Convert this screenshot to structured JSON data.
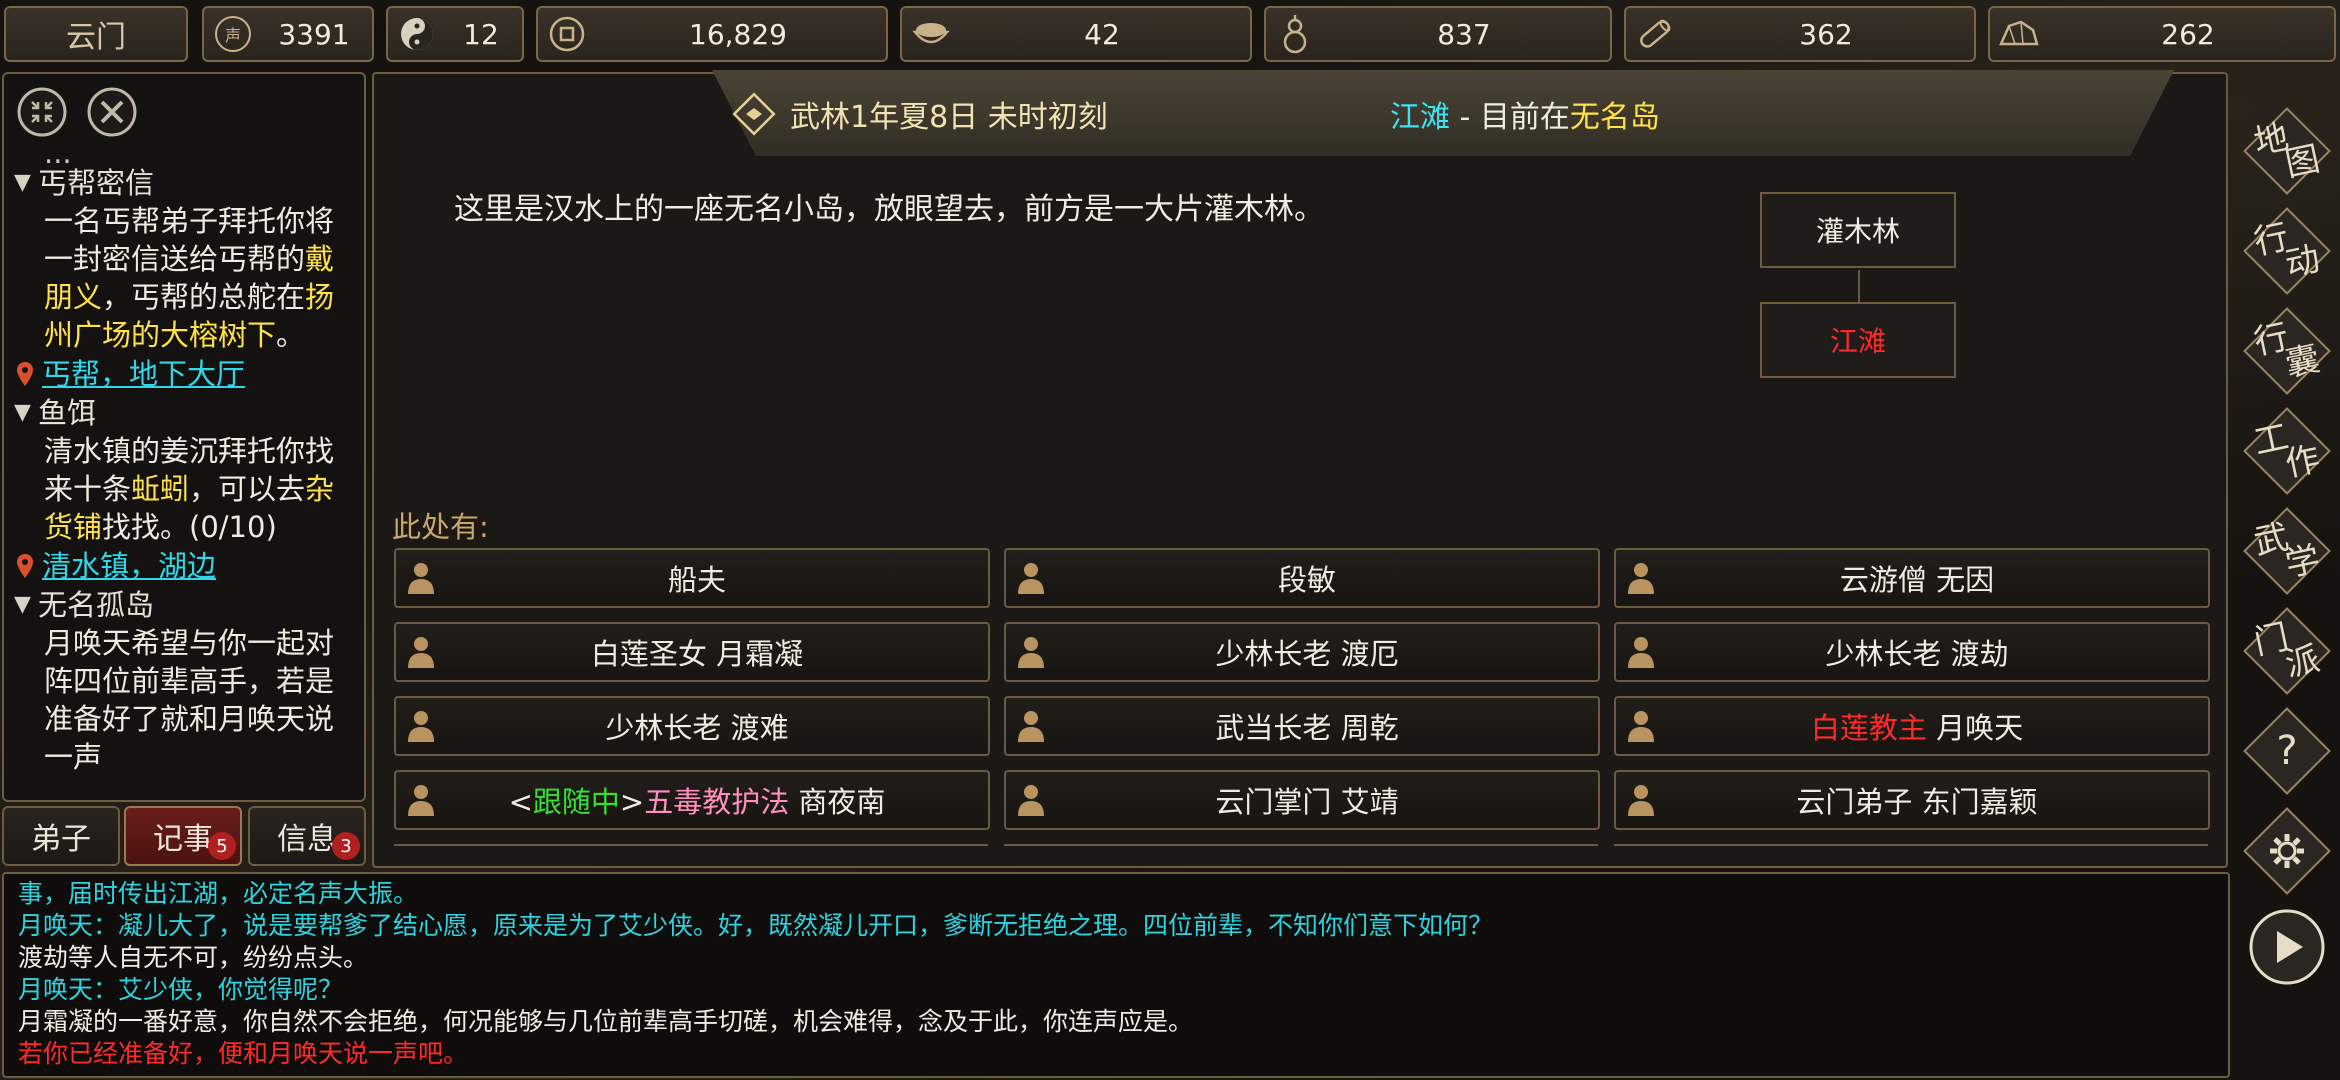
{
  "topbar": {
    "sect": "云门",
    "resources": [
      {
        "name": "reputation",
        "icon": "reputation-icon",
        "value": "3391"
      },
      {
        "name": "taiji",
        "icon": "taiji-icon",
        "value": "12"
      },
      {
        "name": "coins",
        "icon": "coin-icon",
        "value": "16,829"
      },
      {
        "name": "food",
        "icon": "rice-bowl-icon",
        "value": "42"
      },
      {
        "name": "medicine",
        "icon": "gourd-icon",
        "value": "837"
      },
      {
        "name": "wood",
        "icon": "log-icon",
        "value": "362"
      },
      {
        "name": "ore",
        "icon": "ore-icon",
        "value": "262"
      }
    ]
  },
  "quests": {
    "partial_top": "...",
    "items": [
      {
        "title": "丐帮密信",
        "body_parts": [
          {
            "t": "一名丐帮弟子拜托你将一封密信送给丐帮的"
          },
          {
            "t": "戴朋义",
            "hl": true
          },
          {
            "t": "，丐帮的总舵在"
          },
          {
            "t": "扬州广场的大榕树下",
            "hl": true
          },
          {
            "t": "。"
          }
        ],
        "location": "丐帮，地下大厅"
      },
      {
        "title": "鱼饵",
        "body_parts": [
          {
            "t": "清水镇的姜沉拜托你找来十条"
          },
          {
            "t": "蚯蚓",
            "hl": true
          },
          {
            "t": "，可以去"
          },
          {
            "t": "杂货铺",
            "hl": true
          },
          {
            "t": "找找。(0/10)"
          }
        ],
        "location": "清水镇，湖边"
      },
      {
        "title": "无名孤岛",
        "body_parts": [
          {
            "t": "月唤天希望与你一起对阵四位前辈高手，若是准备好了就和月唤天说一声"
          }
        ],
        "location": ""
      }
    ]
  },
  "left_tabs": [
    {
      "label": "弟子",
      "badge": ""
    },
    {
      "label": "记事",
      "badge": "5"
    },
    {
      "label": "信息",
      "badge": "3"
    }
  ],
  "header": {
    "date": "武林1年夏8日 未时初刻",
    "area": "江滩",
    "sep": " - 目前在",
    "place": "无名岛"
  },
  "description": "这里是汉水上的一座无名小岛，放眼望去，前方是一大片灌木林。",
  "minimap": {
    "north": "灌木林",
    "current": "江滩"
  },
  "here_label": "此处有:",
  "npcs": [
    {
      "parts": [
        {
          "t": "船夫"
        }
      ]
    },
    {
      "parts": [
        {
          "t": "段敏"
        }
      ]
    },
    {
      "parts": [
        {
          "t": "云游僧 无因"
        }
      ]
    },
    {
      "parts": [
        {
          "t": "白莲圣女 月霜凝"
        }
      ]
    },
    {
      "parts": [
        {
          "t": "少林长老 渡厄"
        }
      ]
    },
    {
      "parts": [
        {
          "t": "少林长老 渡劫"
        }
      ]
    },
    {
      "parts": [
        {
          "t": "少林长老 渡难"
        }
      ]
    },
    {
      "parts": [
        {
          "t": "武当长老 周乾"
        }
      ]
    },
    {
      "parts": [
        {
          "t": "白莲教主",
          "c": "red"
        },
        {
          "t": " 月唤天"
        }
      ]
    },
    {
      "parts": [
        {
          "t": "<"
        },
        {
          "t": "跟随中",
          "c": "green"
        },
        {
          "t": ">"
        },
        {
          "t": "五毒教护法",
          "c": "pink"
        },
        {
          "t": " 商夜南"
        }
      ]
    },
    {
      "parts": [
        {
          "t": "云门掌门 艾靖"
        }
      ]
    },
    {
      "parts": [
        {
          "t": "云门弟子 东门嘉颖"
        }
      ]
    }
  ],
  "right_nav": [
    {
      "a": "地",
      "b": "图",
      "name": "map-button"
    },
    {
      "a": "行",
      "b": "动",
      "name": "action-button"
    },
    {
      "a": "行",
      "b": "囊",
      "name": "bag-button"
    },
    {
      "a": "工",
      "b": "作",
      "name": "work-button"
    },
    {
      "a": "武",
      "b": "学",
      "name": "martial-arts-button"
    },
    {
      "a": "门",
      "b": "派",
      "name": "sect-button"
    }
  ],
  "help_symbol": "?",
  "log": [
    {
      "text": "事，届时传出江湖，必定名声大振。",
      "c": "cyan"
    },
    {
      "text": "月唤天：凝儿大了，说是要帮爹了结心愿，原来是为了艾少侠。好，既然凝儿开口，爹断无拒绝之理。四位前辈，不知你们意下如何？",
      "c": "cyan"
    },
    {
      "text": "渡劫等人自无不可，纷纷点头。",
      "c": "white"
    },
    {
      "text": "月唤天：艾少侠，你觉得呢？",
      "c": "cyan"
    },
    {
      "text": "月霜凝的一番好意，你自然不会拒绝，何况能够与几位前辈高手切磋，机会难得，念及于此，你连声应是。",
      "c": "white"
    },
    {
      "text": "若你已经准备好，便和月唤天说一声吧。",
      "c": "red"
    }
  ]
}
